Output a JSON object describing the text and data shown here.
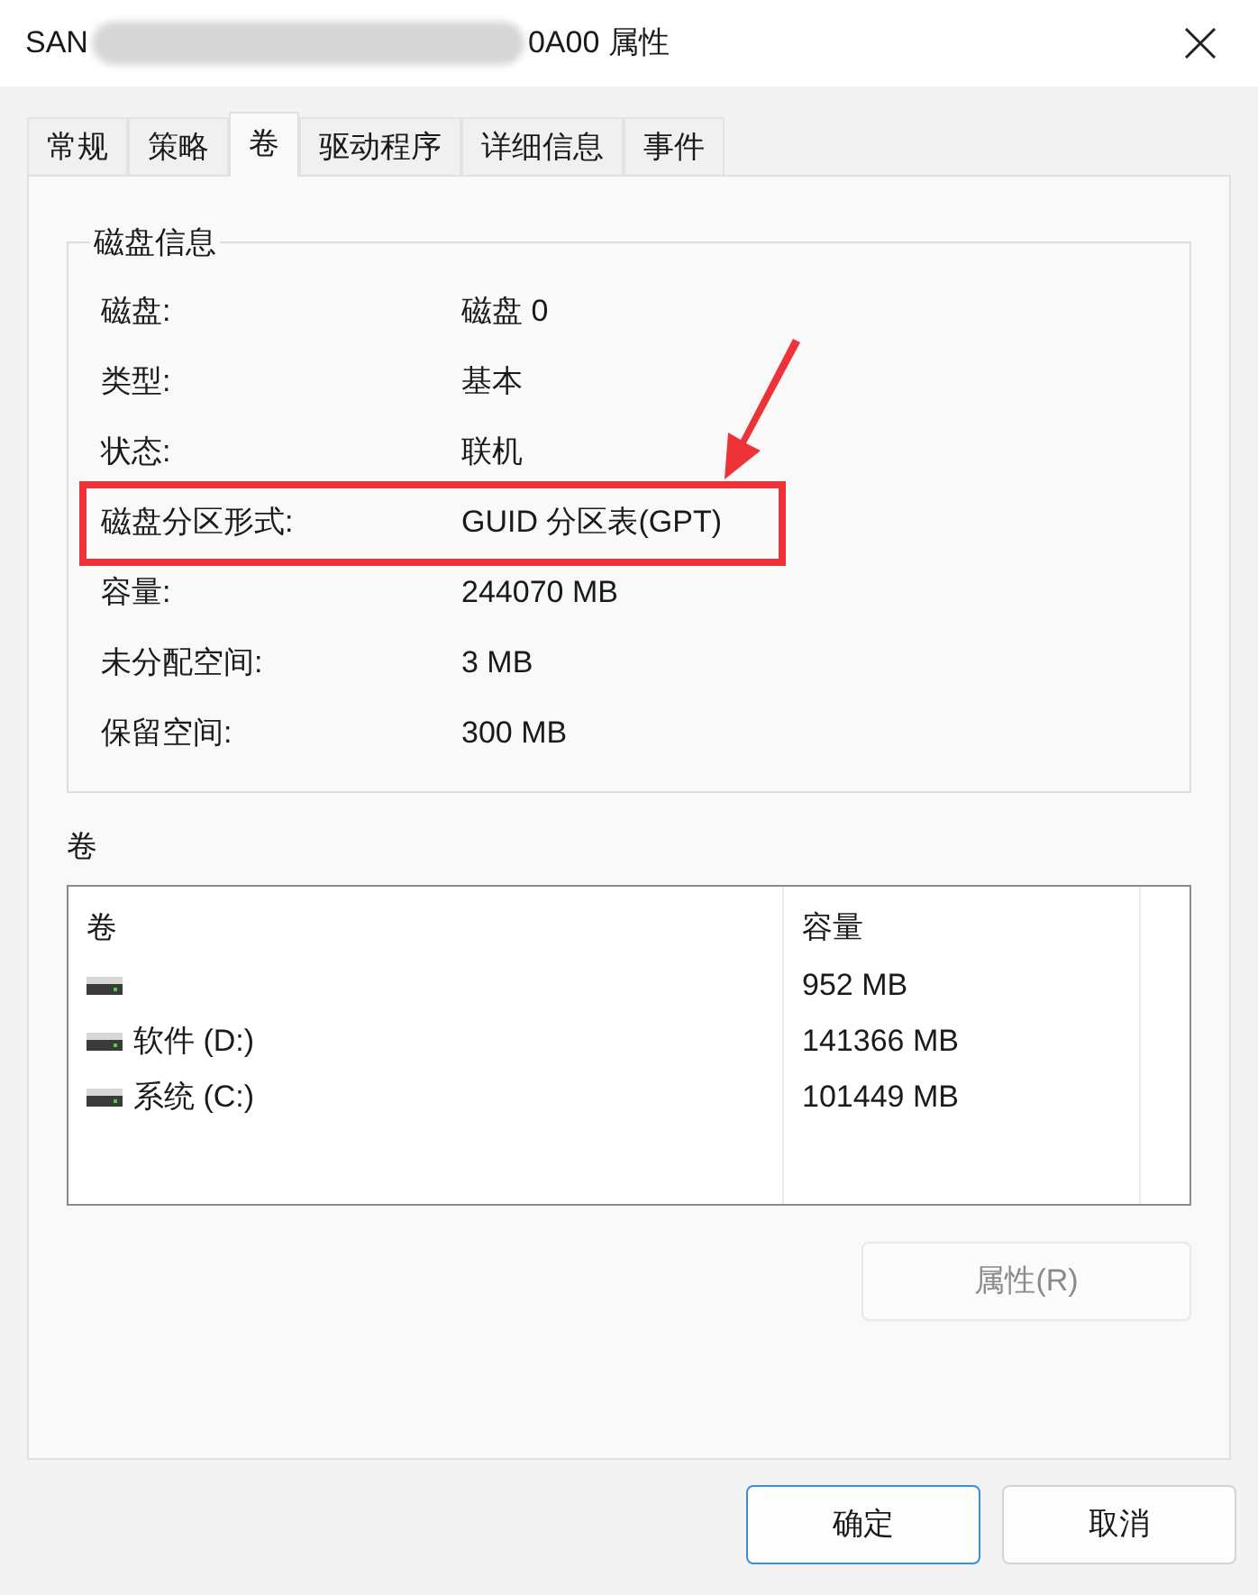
{
  "window": {
    "title_start": "SAN",
    "title_end": "0A00 属性"
  },
  "tabs": [
    {
      "label": "常规",
      "selected": false
    },
    {
      "label": "策略",
      "selected": false
    },
    {
      "label": "卷",
      "selected": true
    },
    {
      "label": "驱动程序",
      "selected": false
    },
    {
      "label": "详细信息",
      "selected": false
    },
    {
      "label": "事件",
      "selected": false
    }
  ],
  "disk_info": {
    "title": "磁盘信息",
    "rows": [
      {
        "label": "磁盘:",
        "value": "磁盘 0",
        "highlighted": false
      },
      {
        "label": "类型:",
        "value": "基本",
        "highlighted": false
      },
      {
        "label": "状态:",
        "value": "联机",
        "highlighted": false
      },
      {
        "label": "磁盘分区形式:",
        "value": "GUID 分区表(GPT)",
        "highlighted": true
      },
      {
        "label": "容量:",
        "value": "244070 MB",
        "highlighted": false
      },
      {
        "label": "未分配空间:",
        "value": "3 MB",
        "highlighted": false
      },
      {
        "label": "保留空间:",
        "value": "300 MB",
        "highlighted": false
      }
    ]
  },
  "volumes": {
    "title": "卷",
    "columns": [
      "卷",
      "容量"
    ],
    "rows": [
      {
        "name": "",
        "capacity": "952 MB"
      },
      {
        "name": "软件 (D:)",
        "capacity": "141366 MB"
      },
      {
        "name": "系统 (C:)",
        "capacity": "101449 MB"
      }
    ]
  },
  "properties_button": {
    "label": "属性(R)",
    "disabled": true
  },
  "buttons": [
    {
      "label": "确定",
      "default": true
    },
    {
      "label": "取消",
      "default": false
    }
  ]
}
